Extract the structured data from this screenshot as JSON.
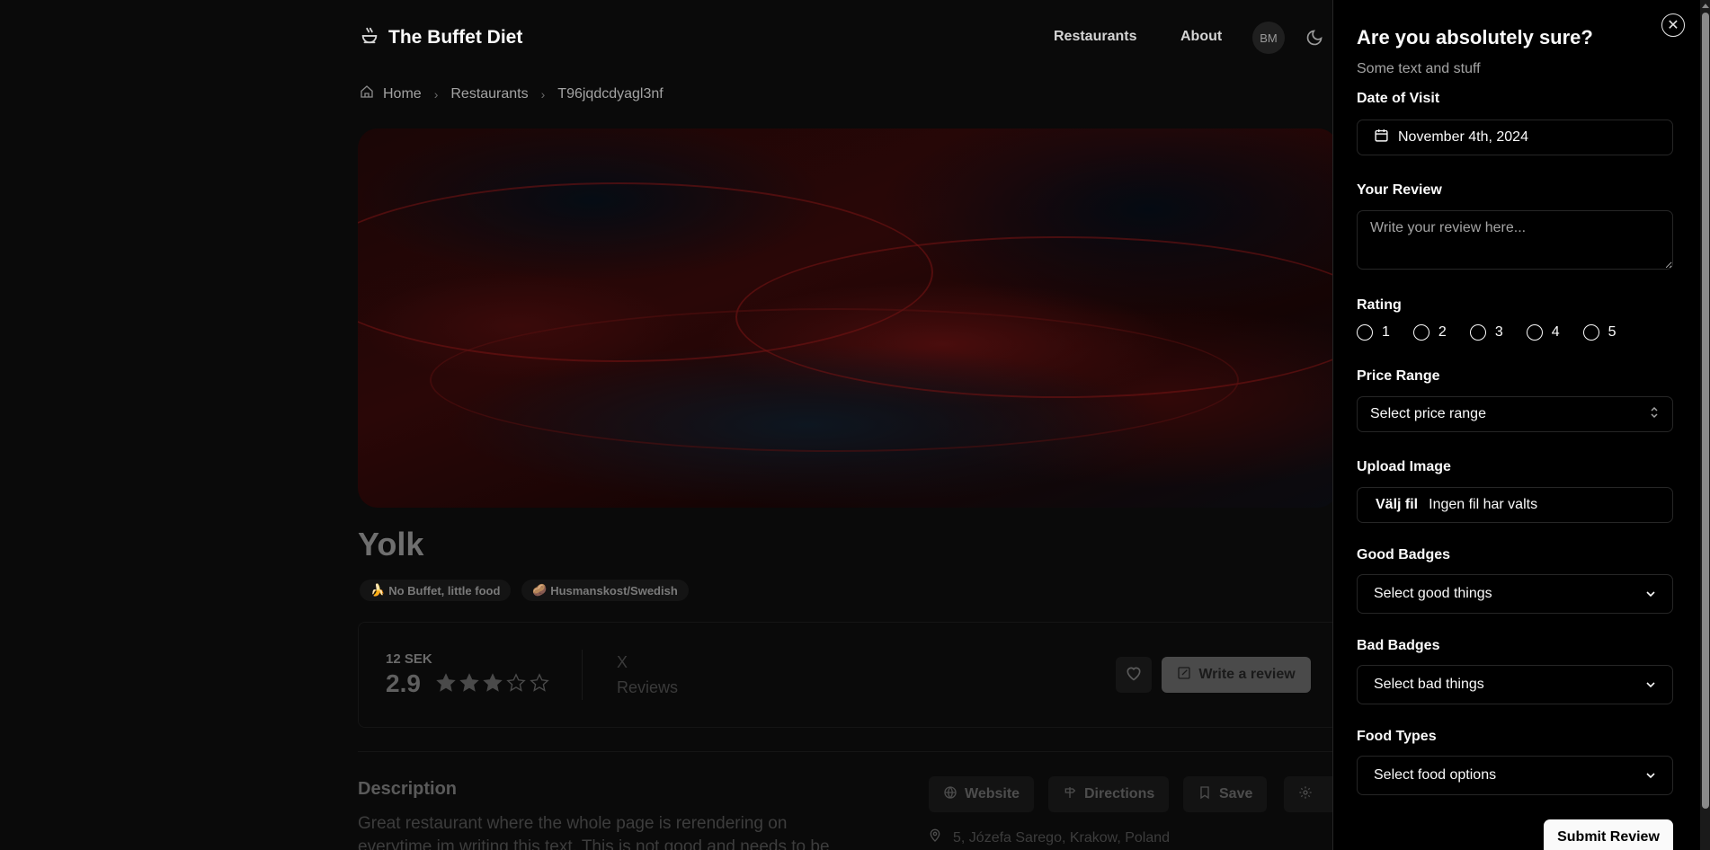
{
  "header": {
    "brand": "The Buffet Diet",
    "nav": [
      "Restaurants",
      "About"
    ],
    "avatar_initials": "BM"
  },
  "breadcrumb": {
    "home": "Home",
    "restaurants": "Restaurants",
    "current": "T96jqdcdyagl3nf"
  },
  "restaurant": {
    "name": "Yolk",
    "tags": [
      "No Buffet, little food",
      "Husmanskost/Swedish"
    ],
    "price": "12 SEK",
    "rating": "2.9",
    "rating_value": 2.9,
    "rating_max": 5,
    "reviews_count": "X",
    "reviews_label": "Reviews",
    "write_review_label": "Write a review",
    "description_heading": "Description",
    "description_text": "Great restaurant where the whole page is rerendering on everytime im writing this text. This is not good and needs to be",
    "actions": [
      "Website",
      "Directions",
      "Save"
    ],
    "address": "5, Józefa Sarego, Krakow, Poland"
  },
  "sheet": {
    "title": "Are you absolutely sure?",
    "subtitle": "Some text and stuff",
    "date_label": "Date of Visit",
    "date_value": "November 4th, 2024",
    "review_label": "Your Review",
    "review_placeholder": "Write your review here...",
    "rating_label": "Rating",
    "rating_options": [
      "1",
      "2",
      "3",
      "4",
      "5"
    ],
    "price_label": "Price Range",
    "price_placeholder": "Select price range",
    "upload_label": "Upload Image",
    "upload_button": "Välj fil",
    "upload_status": "Ingen fil har valts",
    "good_label": "Good Badges",
    "good_placeholder": "Select good things",
    "bad_label": "Bad Badges",
    "bad_placeholder": "Select bad things",
    "food_label": "Food Types",
    "food_placeholder": "Select food options",
    "submit_label": "Submit Review"
  }
}
